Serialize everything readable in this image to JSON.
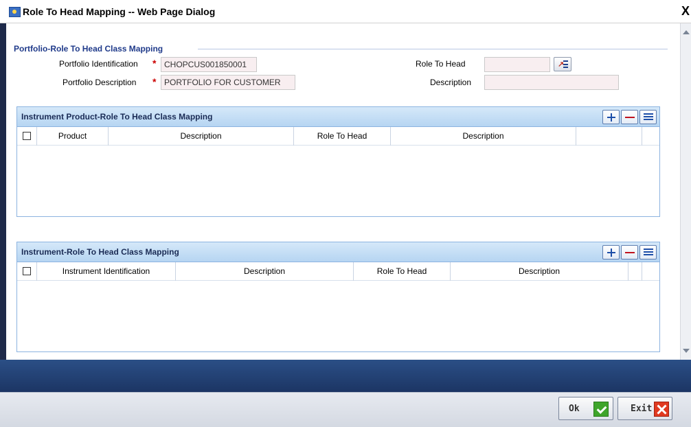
{
  "window": {
    "title": "Role To Head Mapping -- Web Page Dialog",
    "close_glyph": "X"
  },
  "section": {
    "title": "Portfolio-Role To Head Class Mapping"
  },
  "form": {
    "portfolio_id_label": "Portfolio Identification",
    "portfolio_id_value": "CHOPCUS001850001",
    "portfolio_desc_label": "Portfolio Description",
    "portfolio_desc_value": "PORTFOLIO FOR CUSTOMER",
    "role_to_head_label": "Role To Head",
    "role_to_head_value": "",
    "description_label": "Description",
    "description_value": "",
    "required_marker": "*"
  },
  "product_grid": {
    "title": "Instrument Product-Role To Head Class Mapping",
    "columns": [
      "Product",
      "Description",
      "Role To Head",
      "Description"
    ]
  },
  "instrument_grid": {
    "title": "Instrument-Role To Head Class Mapping",
    "columns": [
      "Instrument Identification",
      "Description",
      "Role To Head",
      "Description"
    ]
  },
  "footer": {
    "ok_label": "Ok",
    "exit_label": "Exit"
  },
  "icons": {
    "add": "plus-icon",
    "delete": "minus-icon",
    "view": "list-icon",
    "lov": "list-of-values-icon",
    "ok": "checkmark-icon",
    "exit": "close-icon"
  }
}
